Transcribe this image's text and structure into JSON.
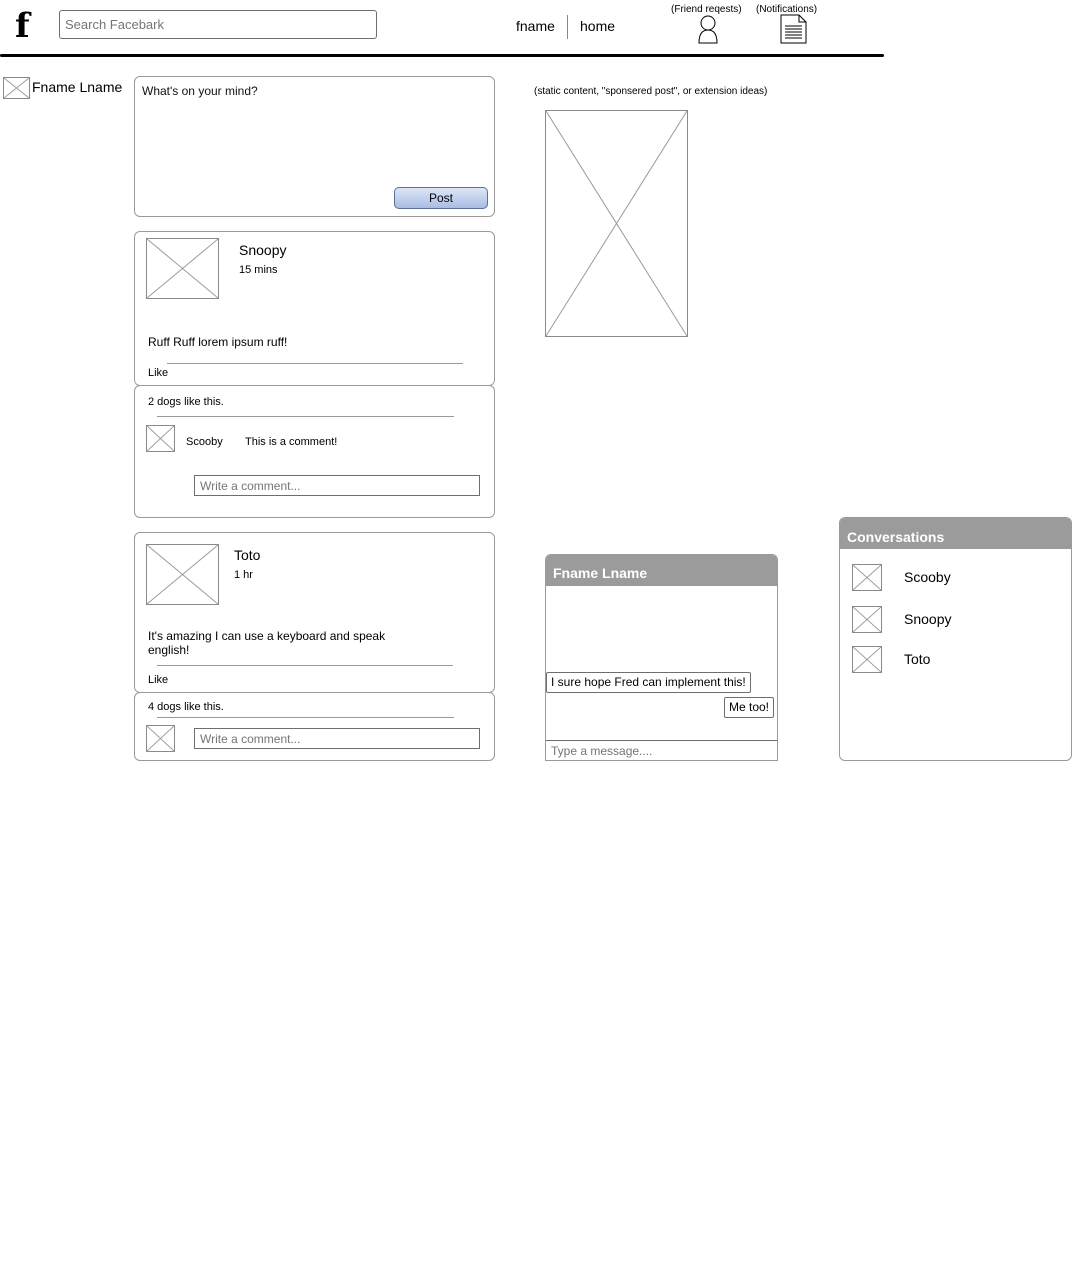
{
  "header": {
    "logo": "f",
    "search_placeholder": "Search Facebark",
    "nav_fname": "fname",
    "nav_home": "home",
    "friend_requests_label": "(Friend reqests)",
    "notifications_label": "(Notifications)"
  },
  "sidebar": {
    "user_name": "Fname Lname"
  },
  "composer": {
    "placeholder": "What's on your mind?",
    "post_label": "Post"
  },
  "posts": [
    {
      "author": "Snoopy",
      "time": "15 mins",
      "body": "Ruff Ruff lorem ipsum ruff!",
      "like_label": "Like",
      "likes_text": "2 dogs like this.",
      "comments": [
        {
          "author": "Scooby",
          "text": "This is a comment!"
        }
      ],
      "comment_placeholder": "Write a comment..."
    },
    {
      "author": "Toto",
      "time": "1 hr",
      "body_line1": "It's amazing I can use a keyboard and speak",
      "body_line2": "english!",
      "like_label": "Like",
      "likes_text": "4 dogs like this.",
      "comment_placeholder": "Write a comment..."
    }
  ],
  "sponsored": {
    "note": "(static content, \"sponsered post\", or extension ideas)"
  },
  "chat": {
    "title": "Fname Lname",
    "messages": [
      {
        "text": "I sure hope Fred can implement this!",
        "side": "left"
      },
      {
        "text": "Me too!",
        "side": "right"
      }
    ],
    "input_placeholder": "Type a message...."
  },
  "conversations": {
    "title": "Conversations",
    "items": [
      {
        "name": "Scooby"
      },
      {
        "name": "Snoopy"
      },
      {
        "name": "Toto"
      }
    ]
  },
  "colors": {
    "panel_header": "#9b9b9b",
    "post_button_top": "#dce6f7",
    "post_button_bottom": "#a9bde2"
  }
}
